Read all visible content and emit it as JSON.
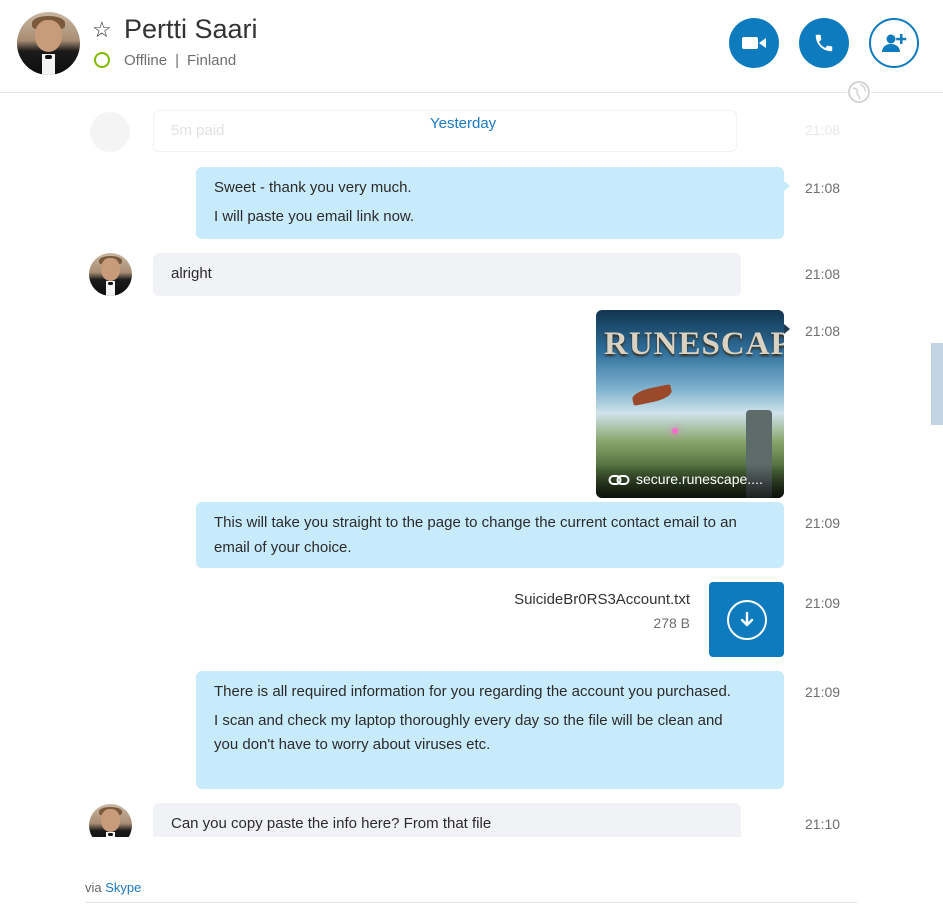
{
  "header": {
    "contact_name": "Pertti Saari",
    "presence": "Offline",
    "location": "Finland",
    "separator": "|",
    "buttons": {
      "video": "video-call",
      "call": "audio-call",
      "add": "add-people"
    }
  },
  "chat": {
    "date_divider": "Yesterday",
    "ghost_message": {
      "text": "5m paid",
      "time": "21:08"
    },
    "messages": [
      {
        "direction": "out",
        "lines": [
          "Sweet - thank you very much.",
          "I will paste you email link now."
        ],
        "time": "21:08"
      },
      {
        "direction": "in",
        "lines": [
          "alright"
        ],
        "time": "21:08"
      },
      {
        "direction": "out",
        "type": "link-preview",
        "logo_text": "RUNESCAPE",
        "domain": "secure.runescape....",
        "time": "21:08"
      },
      {
        "direction": "out",
        "lines": [
          "This will take you straight to the page to change the current contact email to an email of your choice."
        ],
        "time": "21:09"
      },
      {
        "direction": "out",
        "type": "file",
        "file_name": "SuicideBr0RS3Account.txt",
        "file_size": "278 B",
        "time": "21:09"
      },
      {
        "direction": "out",
        "lines": [
          "There is all required information for you regarding the account you purchased.",
          "I scan and check my laptop thoroughly every day so the file will be clean and you don't have to worry about viruses etc."
        ],
        "time": "21:09"
      },
      {
        "direction": "in",
        "lines": [
          "Can you copy paste the info here? From that file"
        ],
        "time": "21:10"
      }
    ]
  },
  "footer": {
    "via_label": "via",
    "via_link": "Skype"
  },
  "colors": {
    "accent": "#0f7bbf",
    "outgoing_bubble": "#c7ebfa",
    "incoming_bubble": "#f1f2f6",
    "presence_ring": "#7fba00"
  }
}
